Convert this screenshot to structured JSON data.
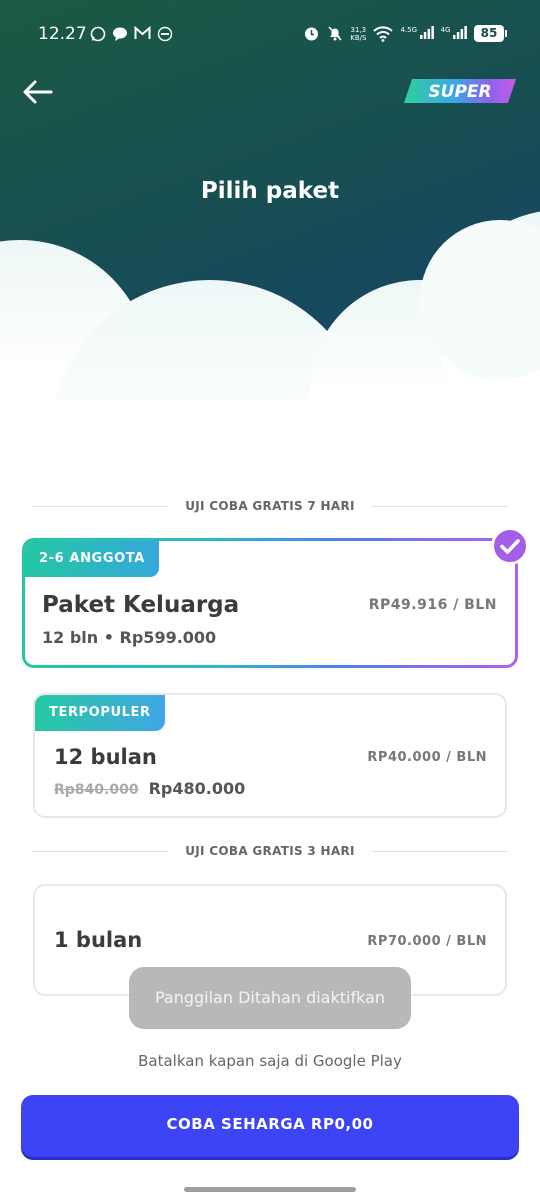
{
  "status_bar": {
    "time": "12.27",
    "net_speed_value": "31,3",
    "net_speed_unit": "KB/S",
    "signal1_label": "4.5G",
    "signal2_label": "4G",
    "battery": "85"
  },
  "header": {
    "title": "Pilih paket",
    "logo_text": "SUPER"
  },
  "sections": [
    {
      "label": "UJI COBA GRATIS 7 HARI"
    },
    {
      "label": "UJI COBA GRATIS 3 HARI"
    }
  ],
  "plans": {
    "family": {
      "badge": "2-6 ANGGOTA",
      "name": "Paket Keluarga",
      "sub": "12 bln • Rp599.000",
      "price": "RP49.916 / BLN",
      "selected": true
    },
    "yearly": {
      "badge": "TERPOPULER",
      "name": "12 bulan",
      "old_price": "Rp840.000",
      "new_price": "Rp480.000",
      "price": "RP40.000 / BLN"
    },
    "monthly": {
      "name": "1 bulan",
      "price": "RP70.000 / BLN"
    }
  },
  "toast": "Panggilan Ditahan diaktifkan",
  "cancel_note": "Batalkan kapan saja di Google Play",
  "cta_label": "COBA SEHARGA RP0,00",
  "colors": {
    "cta": "#3d44f5",
    "selected_check": "#a35fe6",
    "hero_start": "#1b5a43",
    "hero_end": "#143f6e"
  }
}
